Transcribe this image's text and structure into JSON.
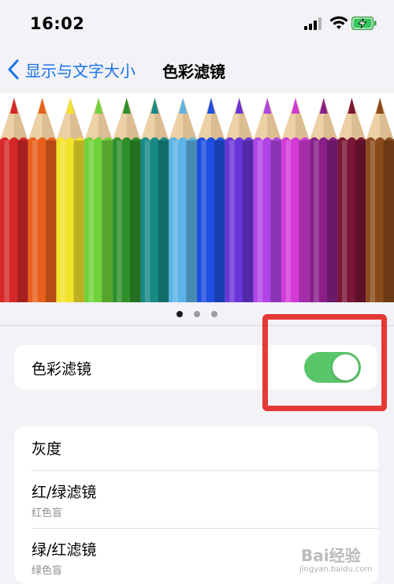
{
  "status_bar": {
    "time": "16:02"
  },
  "nav": {
    "back_label": "显示与文字大小",
    "title": "色彩滤镜"
  },
  "carousel": {
    "pencil_colors": [
      "#d62828",
      "#e8601c",
      "#f2e22c",
      "#6fd23a",
      "#2f8f2a",
      "#178a86",
      "#5cb3e6",
      "#1f4fe0",
      "#6a35d8",
      "#b044e6",
      "#d23ad6",
      "#8a1f8a",
      "#7a1636",
      "#8a4b1c"
    ],
    "dots_count": 3,
    "active_dot": 0
  },
  "toggle_row": {
    "label": "色彩滤镜",
    "enabled": true,
    "accent": "#5ac66a"
  },
  "filters": [
    {
      "title": "灰度",
      "subtitle": ""
    },
    {
      "title": "红/绿滤镜",
      "subtitle": "红色盲"
    },
    {
      "title": "绿/红滤镜",
      "subtitle": "绿色盲"
    }
  ],
  "watermark": {
    "text": "Bai经验",
    "url": "jingyan.baidu.com"
  }
}
